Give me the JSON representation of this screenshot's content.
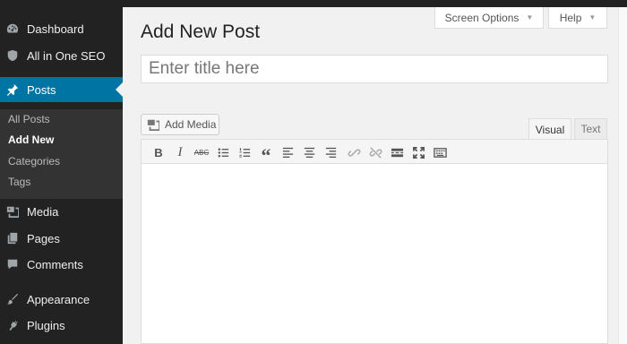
{
  "sidebar": {
    "items": [
      {
        "label": "Dashboard",
        "icon": "dashboard-icon"
      },
      {
        "label": "All in One SEO",
        "icon": "shield-icon"
      },
      {
        "label": "Posts",
        "icon": "pin-icon"
      },
      {
        "label": "Media",
        "icon": "media-icon"
      },
      {
        "label": "Pages",
        "icon": "pages-icon"
      },
      {
        "label": "Comments",
        "icon": "comment-icon"
      },
      {
        "label": "Appearance",
        "icon": "brush-icon"
      },
      {
        "label": "Plugins",
        "icon": "plug-icon"
      }
    ],
    "submenu": [
      {
        "label": "All Posts"
      },
      {
        "label": "Add New"
      },
      {
        "label": "Categories"
      },
      {
        "label": "Tags"
      }
    ],
    "active_color": "#0074a2"
  },
  "header": {
    "screen_options": "Screen Options",
    "help": "Help"
  },
  "page": {
    "title": "Add New Post",
    "title_placeholder": "Enter title here"
  },
  "editor": {
    "add_media": "Add Media",
    "tabs": {
      "visual": "Visual",
      "text": "Text"
    },
    "toolbar": {
      "bold": "B",
      "italic": "I",
      "strikethrough": "ABC",
      "blockquote": "“"
    }
  }
}
